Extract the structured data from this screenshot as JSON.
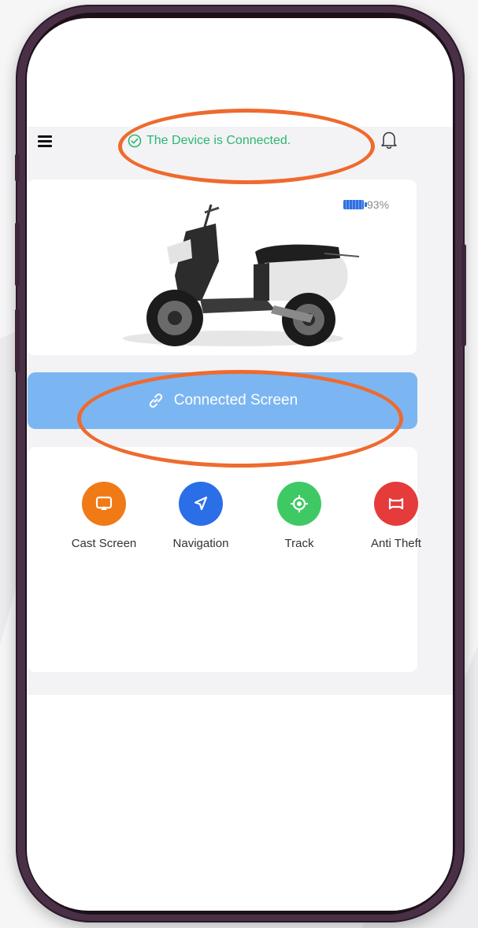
{
  "header": {
    "menu_icon": "hamburger-menu-icon",
    "status_text": "The Device is Connected.",
    "status_icon": "check-circle-icon",
    "status_color": "#2bb673",
    "notification_icon": "bell-icon"
  },
  "vehicle": {
    "image": "electric-scooter",
    "battery_percent_text": "93%",
    "battery_level": 0.93,
    "battery_icon": "battery-icon"
  },
  "connect_button": {
    "label": "Connected Screen",
    "icon": "link-icon",
    "color": "#7bb6f3"
  },
  "features": [
    {
      "label": "Cast Screen",
      "icon": "cast-screen-icon",
      "color": "#f07a16"
    },
    {
      "label": "Navigation",
      "icon": "navigation-arrow-icon",
      "color": "#2a6ee8"
    },
    {
      "label": "Track",
      "icon": "track-target-icon",
      "color": "#3fc964"
    },
    {
      "label": "Anti Theft",
      "icon": "anti-theft-icon",
      "color": "#e53b3b"
    }
  ],
  "annotation_color": "#ef6a2e"
}
